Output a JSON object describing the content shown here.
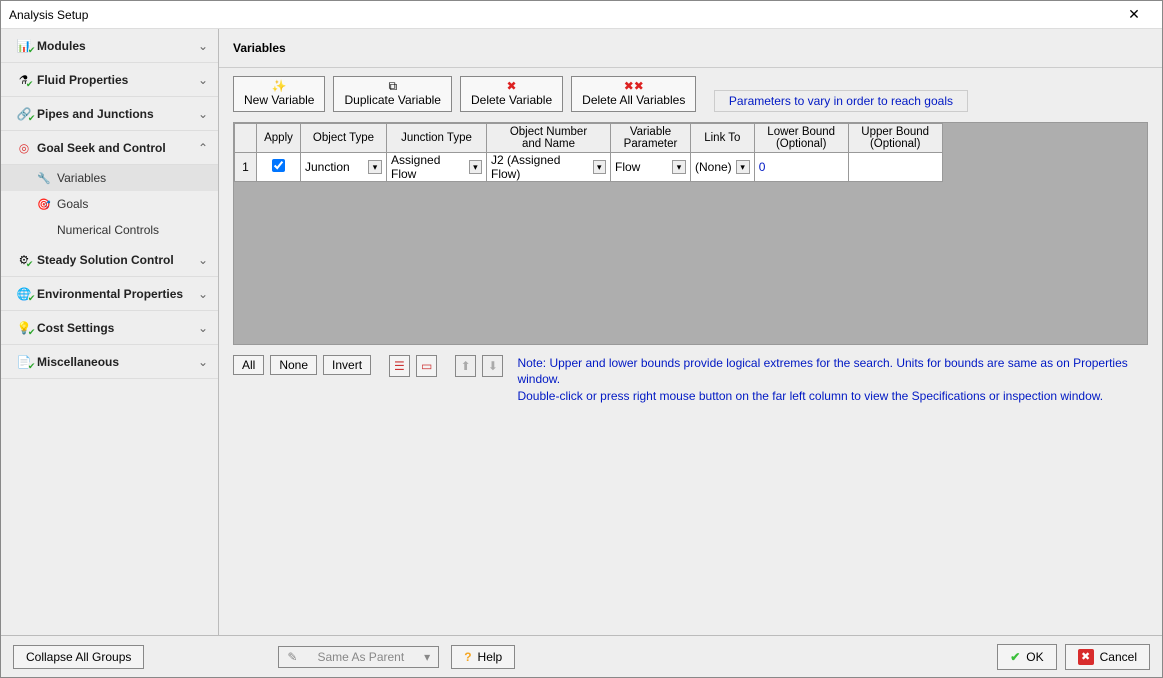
{
  "window": {
    "title": "Analysis Setup"
  },
  "sidebar": {
    "items": [
      {
        "label": "Modules",
        "chev": "⌄"
      },
      {
        "label": "Fluid Properties",
        "chev": "⌄"
      },
      {
        "label": "Pipes and Junctions",
        "chev": "⌄"
      },
      {
        "label": "Goal Seek and Control",
        "chev": "⌃"
      },
      {
        "label": "Steady Solution Control",
        "chev": "⌄"
      },
      {
        "label": "Environmental Properties",
        "chev": "⌄"
      },
      {
        "label": "Cost Settings",
        "chev": "⌄"
      },
      {
        "label": "Miscellaneous",
        "chev": "⌄"
      }
    ],
    "subs": [
      {
        "label": "Variables"
      },
      {
        "label": "Goals"
      },
      {
        "label": "Numerical Controls"
      }
    ]
  },
  "main": {
    "header": "Variables",
    "toolbar": {
      "new": "New Variable",
      "dup": "Duplicate Variable",
      "del": "Delete Variable",
      "delall": "Delete All Variables"
    },
    "param_label": "Parameters to vary in order to reach goals",
    "columns": {
      "apply": "Apply",
      "objtype": "Object Type",
      "jtype": "Junction Type",
      "objnum": "Object Number\nand Name",
      "varparam": "Variable\nParameter",
      "linkto": "Link To",
      "lbound": "Lower Bound\n(Optional)",
      "ubound": "Upper Bound\n(Optional)"
    },
    "rows": [
      {
        "num": "1",
        "apply": true,
        "objtype": "Junction",
        "jtype": "Assigned Flow",
        "objnum": "J2 (Assigned Flow)",
        "varparam": "Flow",
        "linkto": "(None)",
        "lbound": "0",
        "ubound": ""
      }
    ],
    "below": {
      "all": "All",
      "none": "None",
      "invert": "Invert"
    },
    "note_l1": "Note: Upper and lower bounds provide logical extremes for the search. Units for bounds are same as on Properties window.",
    "note_l2": "Double-click or press right mouse button on the far left column to view the Specifications or inspection window."
  },
  "footer": {
    "collapse": "Collapse All Groups",
    "same_as_parent": "Same As Parent",
    "help": "Help",
    "ok": "OK",
    "cancel": "Cancel"
  }
}
